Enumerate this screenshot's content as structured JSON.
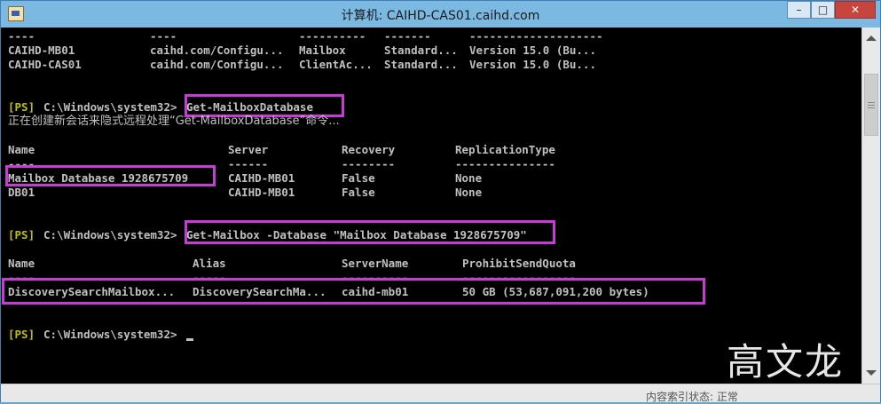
{
  "window": {
    "title": "计算机: CAIHD-CAS01.caihd.com",
    "minimize_glyph": "–",
    "maximize_glyph": "□",
    "close_glyph": "✕"
  },
  "console": {
    "top_rows": [
      {
        "c1": "----",
        "c2": "----",
        "c3": "----------",
        "c4": "-------",
        "c5": "--------------------"
      },
      {
        "c1": "CAIHD-MB01",
        "c2": "caihd.com/Configu...",
        "c3": "Mailbox",
        "c4": "Standard...",
        "c5": "Version 15.0 (Bu..."
      },
      {
        "c1": "CAIHD-CAS01",
        "c2": "caihd.com/Configu...",
        "c3": "ClientAc...",
        "c4": "Standard...",
        "c5": "Version 15.0 (Bu..."
      }
    ],
    "prompt_tag": "[PS]",
    "prompt_path": "C:\\Windows\\system32>",
    "cmd1": "Get-MailboxDatabase",
    "cmd1_msg": "正在创建新会话来隐式远程处理“Get-MailboxDatabase”命令...",
    "db_header": {
      "name": "Name",
      "server": "Server",
      "recovery": "Recovery",
      "repl": "ReplicationType"
    },
    "db_sep": {
      "name": "----",
      "server": "------",
      "recovery": "--------",
      "repl": "---------------"
    },
    "db_rows": [
      {
        "name": "Mailbox Database 1928675709",
        "server": "CAIHD-MB01",
        "recovery": "False",
        "repl": "None"
      },
      {
        "name": "DB01",
        "server": "CAIHD-MB01",
        "recovery": "False",
        "repl": "None"
      }
    ],
    "cmd2": "Get-Mailbox -Database \"Mailbox Database 1928675709\"",
    "mb_header": {
      "name": "Name",
      "alias": "Alias",
      "server": "ServerName",
      "quota": "ProhibitSendQuota"
    },
    "mb_sep": {
      "name": "----",
      "alias": "-----",
      "server": "----------",
      "quota": "-----------------"
    },
    "mb_row": {
      "name": "DiscoverySearchMailbox...",
      "alias": "DiscoverySearchMa...",
      "server": "caihd-mb01",
      "quota": "50 GB (53,687,091,200 bytes)"
    }
  },
  "status_bar": {
    "text": "内容索引状态: 正常"
  },
  "watermark": "高文龙",
  "colors": {
    "highlight_box": "#c93bd6",
    "console_bg": "#000000",
    "title_bar": "#7cb9e2"
  }
}
